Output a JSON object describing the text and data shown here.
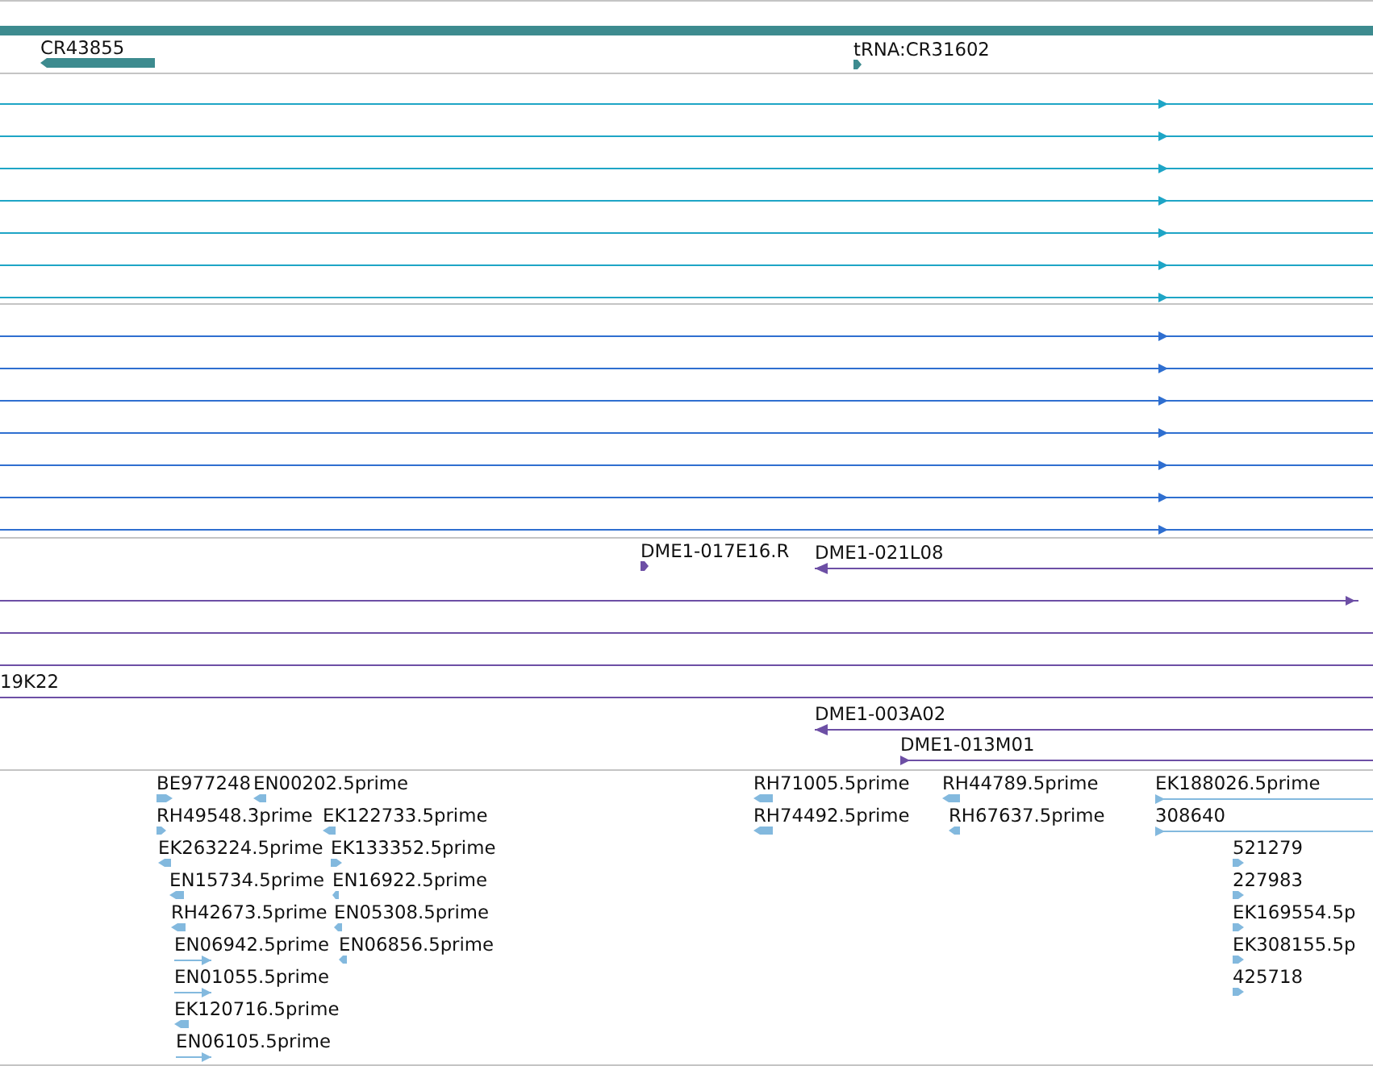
{
  "tracks": [
    {
      "color": "#3d8b8f",
      "features": [
        {
          "kind": "none"
        },
        {
          "label": "CR43855",
          "kind": "minus"
        },
        {
          "label": "tRNA:CR31602",
          "kind": "plus"
        }
      ]
    },
    {
      "color": "#1ea5c6",
      "features": [
        {
          "kind": "plus"
        },
        {
          "kind": "plus"
        },
        {
          "kind": "plus"
        },
        {
          "kind": "plus"
        },
        {
          "kind": "plus"
        },
        {
          "kind": "plus"
        },
        {
          "kind": "plus"
        }
      ]
    },
    {
      "color": "#2f6fd0",
      "features": [
        {
          "kind": "plus"
        },
        {
          "kind": "plus"
        },
        {
          "kind": "plus"
        },
        {
          "kind": "plus"
        },
        {
          "kind": "plus"
        },
        {
          "kind": "plus"
        },
        {
          "kind": "plus"
        }
      ]
    },
    {
      "color": "#6d4fa5",
      "features": [
        {
          "label": "DME1-017E16.R",
          "kind": "plus"
        },
        {
          "label": "DME1-021L08",
          "kind": "minus"
        },
        {
          "kind": "plus"
        },
        {
          "kind": "none"
        },
        {
          "kind": "none"
        },
        {
          "label": "19K22",
          "kind": "none"
        },
        {
          "label": "DME1-003A02",
          "kind": "minus"
        },
        {
          "label": "DME1-013M01",
          "kind": "plus"
        }
      ]
    },
    {
      "color": "#83b9de",
      "features": [
        {
          "label": "BE977248",
          "kind": "plus"
        },
        {
          "label": "EN00202.5prime",
          "kind": "minus"
        },
        {
          "label": "RH71005.5prime",
          "kind": "minus"
        },
        {
          "label": "RH44789.5prime",
          "kind": "minus"
        },
        {
          "label": "EK188026.5prime",
          "kind": "plus"
        },
        {
          "label": "RH49548.3prime",
          "kind": "plus"
        },
        {
          "label": "EK122733.5prime",
          "kind": "minus"
        },
        {
          "label": "RH74492.5prime",
          "kind": "minus"
        },
        {
          "label": "RH67637.5prime",
          "kind": "minus"
        },
        {
          "label": "308640",
          "kind": "plus"
        },
        {
          "label": "EK263224.5prime",
          "kind": "minus"
        },
        {
          "label": "EK133352.5prime",
          "kind": "plus"
        },
        {
          "label": "521279",
          "kind": "plus"
        },
        {
          "label": "EN15734.5prime",
          "kind": "minus"
        },
        {
          "label": "EN16922.5prime",
          "kind": "minus"
        },
        {
          "label": "227983",
          "kind": "plus"
        },
        {
          "label": "RH42673.5prime",
          "kind": "minus"
        },
        {
          "label": "EN05308.5prime",
          "kind": "minus"
        },
        {
          "label": "EK169554.5p",
          "kind": "plus"
        },
        {
          "label": "EN06942.5prime",
          "kind": "plus"
        },
        {
          "label": "EN06856.5prime",
          "kind": "minus"
        },
        {
          "label": "EK308155.5p",
          "kind": "plus"
        },
        {
          "label": "EN01055.5prime",
          "kind": "plus"
        },
        {
          "label": "425718",
          "kind": "plus"
        },
        {
          "label": "EK120716.5prime",
          "kind": "minus"
        },
        {
          "label": "EN06105.5prime",
          "kind": "plus"
        }
      ]
    }
  ]
}
